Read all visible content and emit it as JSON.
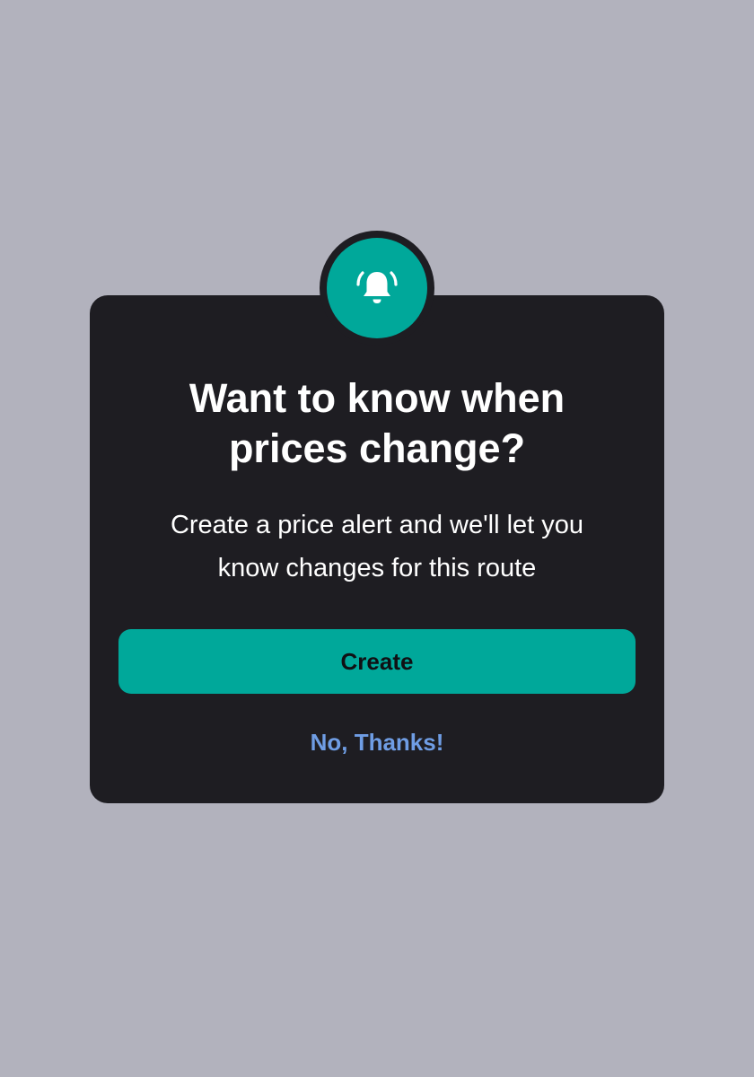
{
  "dialog": {
    "icon": "bell-ringing-icon",
    "title": "Want to know when prices change?",
    "message": "Create a price alert and we'll let you know changes for this route",
    "create_label": "Create",
    "dismiss_label": "No, Thanks!"
  },
  "colors": {
    "backdrop": "#b2b2bd",
    "dialog_bg": "#1e1d22",
    "accent": "#00a89a",
    "link": "#6f9de4"
  }
}
